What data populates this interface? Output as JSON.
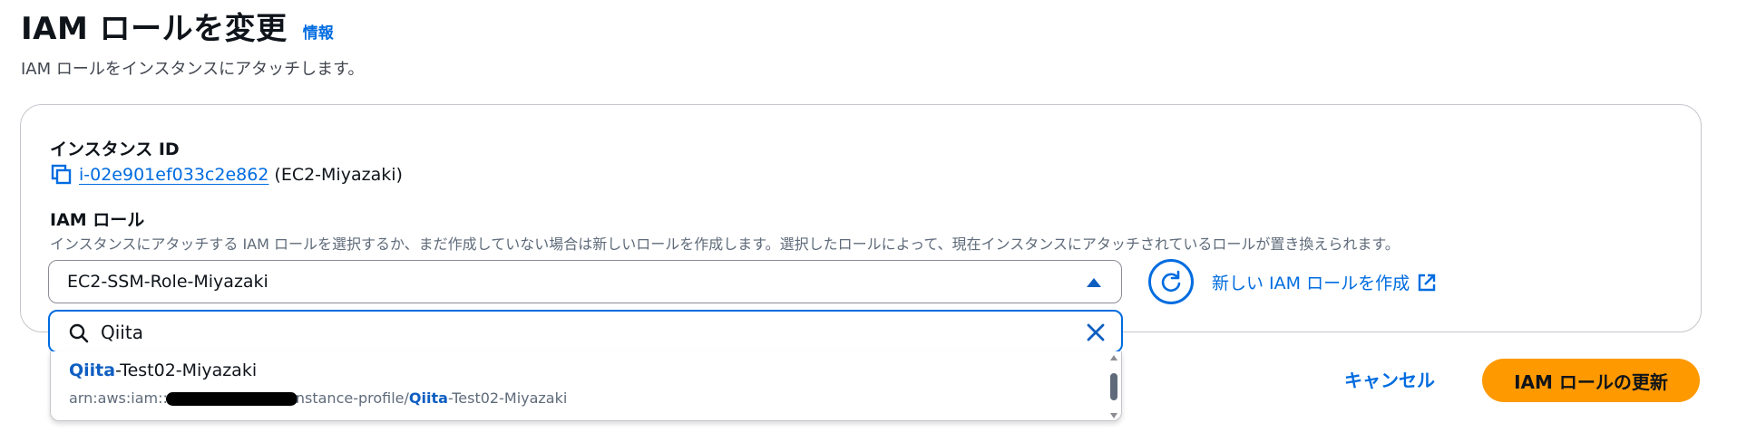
{
  "header": {
    "title": "IAM ロールを変更",
    "info_link": "情報",
    "subtitle": "IAM ロールをインスタンスにアタッチします。"
  },
  "instance": {
    "label": "インスタンス ID",
    "id": "i-02e901ef033c2e862",
    "name": "(EC2-Miyazaki)"
  },
  "iam_role": {
    "label": "IAM ロール",
    "description": "インスタンスにアタッチする IAM ロールを選択するか、まだ作成していない場合は新しいロールを作成します。選択したロールによって、現在インスタンスにアタッチされているロールが置き換えられます。",
    "selected_value": "EC2-SSM-Role-Miyazaki",
    "create_link": "新しい IAM ロールを作成",
    "search_value": "Qiita",
    "options": [
      {
        "match": "Qiita",
        "title_rest": "-Test02-Miyazaki",
        "arn_prefix": "arn:aws:iam::",
        "arn_mid": "nstance-profile/",
        "arn_match": "Qiita",
        "arn_rest": "-Test02-Miyazaki"
      }
    ]
  },
  "actions": {
    "cancel": "キャンセル",
    "update": "IAM ロールの更新"
  },
  "colors": {
    "link": "#006ce0",
    "primary_button": "#ff9900",
    "text": "#0f141a",
    "muted_text": "#5f6b7a"
  },
  "icons": [
    "copy-icon",
    "caret-up-icon",
    "refresh-icon",
    "external-link-icon",
    "search-icon",
    "clear-icon"
  ]
}
